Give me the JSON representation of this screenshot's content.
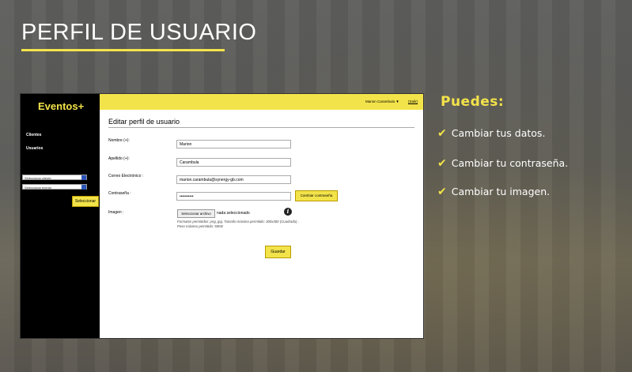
{
  "slide": {
    "title": "PERFIL DE USUARIO",
    "accent_color": "#f3e34a"
  },
  "app": {
    "logo": "Eventos+",
    "sidebar": {
      "links": [
        "Clientes",
        "Usuarios"
      ],
      "client_select": "Seleccionar cliente",
      "event_select": "Seleccionar evento",
      "select_button": "Seleccionar"
    },
    "header": {
      "user_menu": "Marion Carambula ▼",
      "logout": "(Salir)"
    },
    "form": {
      "title": "Editar perfil de usuario",
      "fields": [
        {
          "label": "Nombre (+):",
          "value": "Marion"
        },
        {
          "label": "Apellido (+):",
          "value": "Carambula"
        },
        {
          "label": "Correo Electrónico :",
          "value": "marion.carambula@synergy-gb.com"
        },
        {
          "label": "Contraseña :",
          "value": "••••••••••"
        }
      ],
      "change_password_button": "Cambiar contraseña",
      "image_label": "Imagen :",
      "file_button": "Seleccionar archivo",
      "file_status": "nada seleccionado",
      "info_icon": "i",
      "hint": "Formatos permitidos: png, jpg. Tamaño máximo permitido: 300x300 (Cuadrado) . Peso máximo permitido: 50KB",
      "save_button": "Guardar"
    }
  },
  "features": {
    "heading": "Puedes:",
    "items": [
      "Cambiar tus datos.",
      "Cambiar tu contraseña.",
      "Cambiar tu imagen."
    ],
    "check_glyph": "✔"
  }
}
